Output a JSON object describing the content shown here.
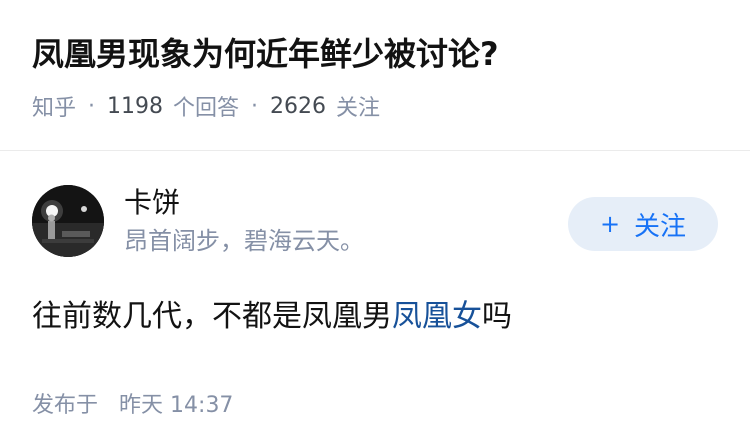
{
  "question": {
    "title": "凤凰男现象为何近年鲜少被讨论?",
    "source": "知乎",
    "separator": "·",
    "answers_count": "1198",
    "answers_label": "个回答",
    "followers_count": "2626",
    "followers_label": "关注"
  },
  "answer": {
    "author_name": "卡饼",
    "author_bio": "昂首阔步，碧海云天。",
    "follow_button": {
      "icon": "+",
      "label": "关注"
    },
    "content_before": "往前数几代，不都是凤凰男",
    "content_link": "凤凰女",
    "content_after": "吗",
    "publish_label": "发布于",
    "publish_day": "昨天",
    "publish_time": "14:37"
  },
  "colors": {
    "accent": "#1772f6",
    "link": "#175199",
    "meta": "#8590a6",
    "follow_bg": "#e6eef8"
  }
}
